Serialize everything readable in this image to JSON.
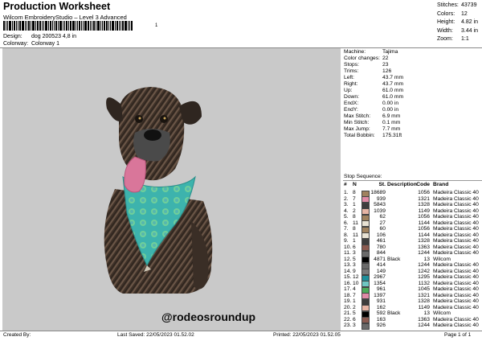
{
  "header": {
    "title": "Production Worksheet",
    "subtitle": "Wilcom EmbroideryStudio – Level 3 Advanced",
    "barcode_number": "1",
    "design_label": "Design:",
    "design_value": "dog 200523 4,8 in",
    "colorway_label": "Colorway:",
    "colorway_value": "Colorway 1",
    "stats": [
      {
        "label": "Stitches:",
        "value": "43739"
      },
      {
        "label": "Colors:",
        "value": "12"
      },
      {
        "label": "Height:",
        "value": "4.82 in"
      },
      {
        "label": "Width:",
        "value": "3.44 in"
      },
      {
        "label": "Zoom:",
        "value": "1:1"
      }
    ]
  },
  "design_image": {
    "handle_text": "@rodeosroundup",
    "colors": {
      "bandana": "#3db3ad",
      "tongue": "#d9769a",
      "fur": "#4a3a30",
      "background": "#c9c9c9"
    }
  },
  "machine_info": [
    {
      "label": "Machine:",
      "value": "Tajima"
    },
    {
      "label": "Color changes:",
      "value": "22"
    },
    {
      "label": "Stops:",
      "value": "23"
    },
    {
      "label": "Trims:",
      "value": "126"
    },
    {
      "label": "Left:",
      "value": "43.7 mm"
    },
    {
      "label": "Right:",
      "value": "43.7 mm"
    },
    {
      "label": "Up:",
      "value": "61.0 mm"
    },
    {
      "label": "Down:",
      "value": "61.0 mm"
    },
    {
      "label": "EndX:",
      "value": "0.00 in"
    },
    {
      "label": "EndY:",
      "value": "0.00 in"
    },
    {
      "label": "Max Stitch:",
      "value": "6.9 mm"
    },
    {
      "label": "Min Stitch:",
      "value": "0.1 mm"
    },
    {
      "label": "Max Jump:",
      "value": "7.7 mm"
    },
    {
      "label": "Total Bobbin:",
      "value": "175.31ft"
    }
  ],
  "stop_sequence": {
    "title": "Stop Sequence:",
    "columns": [
      "#",
      "N",
      "St.",
      "Description",
      "Code",
      "Brand"
    ],
    "rows": [
      {
        "num": "1.",
        "col": "8",
        "color": "#a0825f",
        "st": "18689",
        "desc": "",
        "code": "1056",
        "brand": "Madeira Classic 40"
      },
      {
        "num": "2.",
        "col": "7",
        "color": "#e08aa6",
        "st": "939",
        "desc": "",
        "code": "1321",
        "brand": "Madeira Classic 40"
      },
      {
        "num": "3.",
        "col": "1",
        "color": "#3d3d3d",
        "st": "5843",
        "desc": "",
        "code": "1328",
        "brand": "Madeira Classic 40"
      },
      {
        "num": "4.",
        "col": "2",
        "color": "#e6b4a4",
        "st": "1039",
        "desc": "",
        "code": "1149",
        "brand": "Madeira Classic 40"
      },
      {
        "num": "5.",
        "col": "8",
        "color": "#a0825f",
        "st": "62",
        "desc": "",
        "code": "1056",
        "brand": "Madeira Classic 40"
      },
      {
        "num": "6.",
        "col": "11",
        "color": "#e8e2d4",
        "st": "27",
        "desc": "",
        "code": "1144",
        "brand": "Madeira Classic 40"
      },
      {
        "num": "7.",
        "col": "8",
        "color": "#a0825f",
        "st": "60",
        "desc": "",
        "code": "1056",
        "brand": "Madeira Classic 40"
      },
      {
        "num": "8.",
        "col": "11",
        "color": "#e8e2d4",
        "st": "106",
        "desc": "",
        "code": "1144",
        "brand": "Madeira Classic 40"
      },
      {
        "num": "9.",
        "col": "1",
        "color": "#3d3d3d",
        "st": "461",
        "desc": "",
        "code": "1328",
        "brand": "Madeira Classic 40"
      },
      {
        "num": "10.",
        "col": "6",
        "color": "#8a5a50",
        "st": "780",
        "desc": "",
        "code": "1363",
        "brand": "Madeira Classic 40"
      },
      {
        "num": "11.",
        "col": "3",
        "color": "#6a6a6a",
        "st": "844",
        "desc": "",
        "code": "1244",
        "brand": "Madeira Classic 40"
      },
      {
        "num": "12.",
        "col": "5",
        "color": "#000000",
        "st": "4871",
        "desc": "Black",
        "code": "13",
        "brand": "Wilcom"
      },
      {
        "num": "13.",
        "col": "3",
        "color": "#6a6a6a",
        "st": "414",
        "desc": "",
        "code": "1244",
        "brand": "Madeira Classic 40"
      },
      {
        "num": "14.",
        "col": "9",
        "color": "#7a7a7a",
        "st": "149",
        "desc": "",
        "code": "1242",
        "brand": "Madeira Classic 40"
      },
      {
        "num": "15.",
        "col": "12",
        "color": "#1f8f9a",
        "st": "2967",
        "desc": "",
        "code": "1295",
        "brand": "Madeira Classic 40"
      },
      {
        "num": "16.",
        "col": "10",
        "color": "#6fc6c2",
        "st": "1354",
        "desc": "",
        "code": "1132",
        "brand": "Madeira Classic 40"
      },
      {
        "num": "17.",
        "col": "4",
        "color": "#4caa5a",
        "st": "961",
        "desc": "",
        "code": "1045",
        "brand": "Madeira Classic 40"
      },
      {
        "num": "18.",
        "col": "7",
        "color": "#e08aa6",
        "st": "1397",
        "desc": "",
        "code": "1321",
        "brand": "Madeira Classic 40"
      },
      {
        "num": "19.",
        "col": "1",
        "color": "#3d3d3d",
        "st": "931",
        "desc": "",
        "code": "1328",
        "brand": "Madeira Classic 40"
      },
      {
        "num": "20.",
        "col": "2",
        "color": "#e6b4a4",
        "st": "162",
        "desc": "",
        "code": "1149",
        "brand": "Madeira Classic 40"
      },
      {
        "num": "21.",
        "col": "5",
        "color": "#000000",
        "st": "592",
        "desc": "Black",
        "code": "13",
        "brand": "Wilcom"
      },
      {
        "num": "22.",
        "col": "6",
        "color": "#8a5a50",
        "st": "163",
        "desc": "",
        "code": "1363",
        "brand": "Madeira Classic 40"
      },
      {
        "num": "23.",
        "col": "3",
        "color": "#6a6a6a",
        "st": "926",
        "desc": "",
        "code": "1244",
        "brand": "Madeira Classic 40"
      }
    ]
  },
  "footer": {
    "created_by": "Created By:",
    "last_saved": "Last Saved: 22/05/2023 01.52.02",
    "printed": "Printed: 22/05/2023 01.52.05",
    "page": "Page 1 of 1"
  }
}
